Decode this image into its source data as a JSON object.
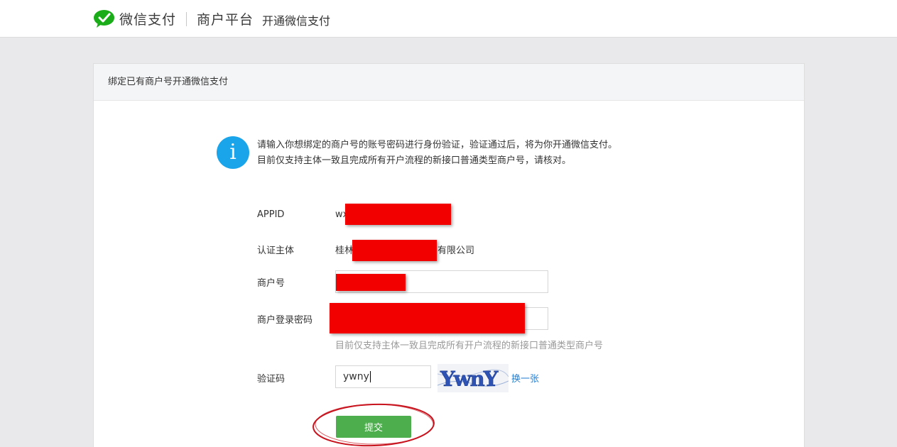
{
  "header": {
    "brand": "微信支付",
    "platform": "商户平台",
    "subtitle": "开通微信支付"
  },
  "panel": {
    "title": "绑定已有商户号开通微信支付"
  },
  "notice": {
    "line1": "请输入你想绑定的商户号的账号密码进行身份验证，验证通过后，将为你开通微信支付。",
    "line2": "目前仅支持主体一致且完成所有开户流程的新接口普通类型商户号，请核对。"
  },
  "form": {
    "appid_label": "APPID",
    "appid_value": "wx",
    "entity_label": "认证主体",
    "entity_prefix": "桂林",
    "entity_suffix": "有限公司",
    "merchant_label": "商户号",
    "password_label": "商户登录密码",
    "password_hint": "目前仅支持主体一致且完成所有开户流程的新接口普通类型商户号",
    "captcha_label": "验证码",
    "captcha_value": "ywny",
    "captcha_image_text": "YwnY",
    "refresh_label": "换一张",
    "submit_label": "提交"
  },
  "colors": {
    "brand_green": "#1aad19",
    "button_green": "#4cae4c",
    "info_blue": "#1aa4ea",
    "link_blue": "#2a7fd1",
    "redaction_red": "#f20000",
    "annotation_red": "#c8141e"
  }
}
